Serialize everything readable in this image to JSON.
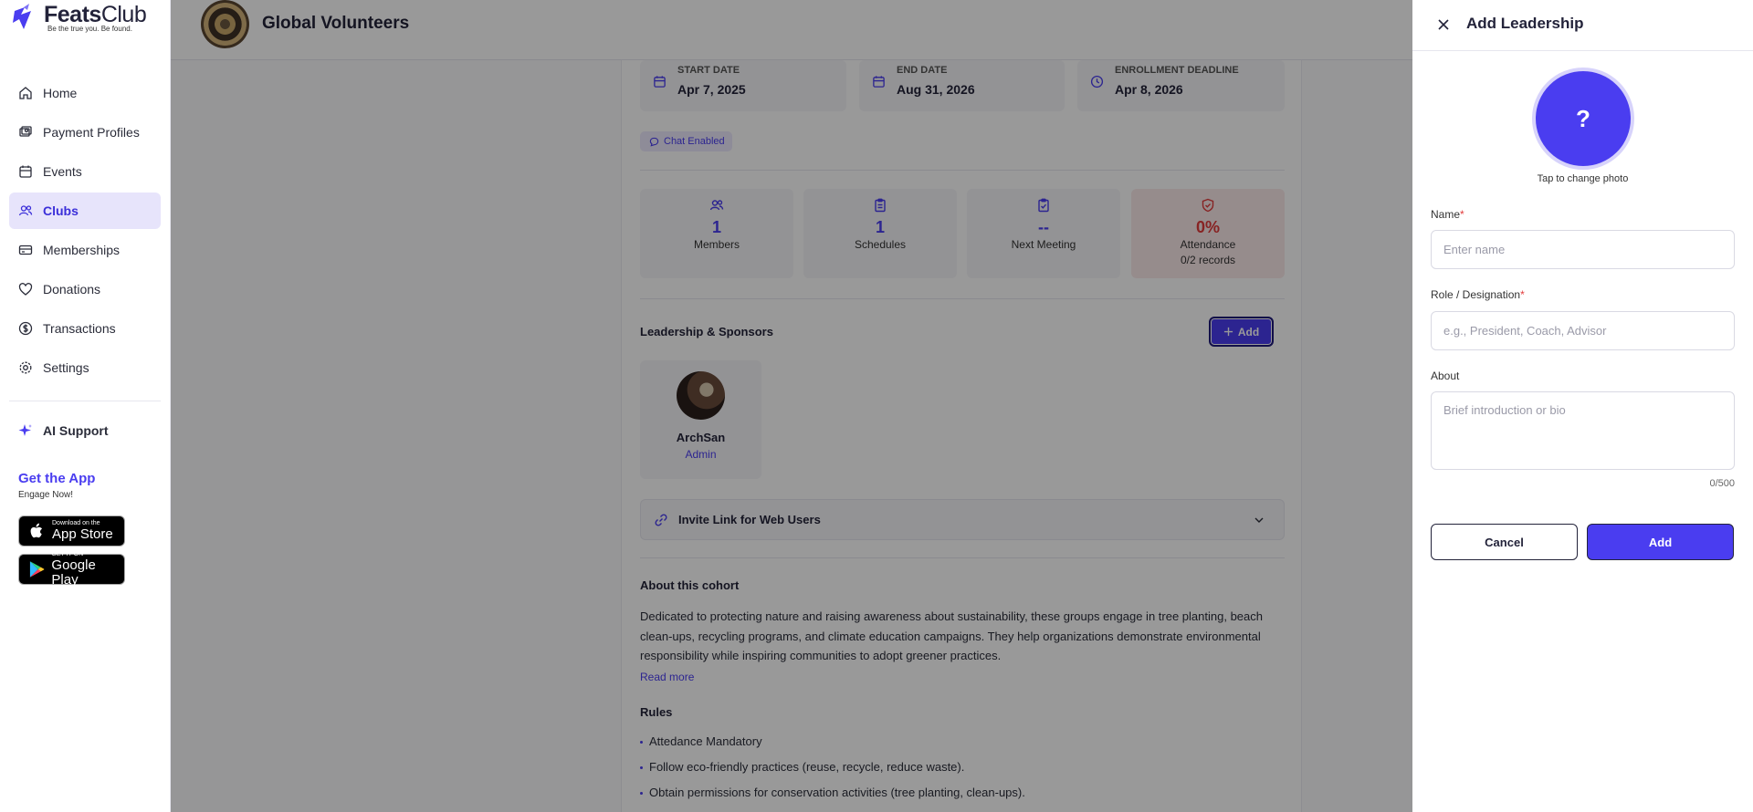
{
  "brand": {
    "name_bold": "Feats",
    "name_light": "Club",
    "tagline": "Be the true you. Be found."
  },
  "colors": {
    "accent": "#4a3df0",
    "danger": "#e23b3b",
    "active_bg": "#e7e4fb"
  },
  "sidebar": {
    "items": [
      {
        "label": "Home",
        "icon": "home-icon"
      },
      {
        "label": "Payment Profiles",
        "icon": "payment-profiles-icon"
      },
      {
        "label": "Events",
        "icon": "calendar-icon"
      },
      {
        "label": "Clubs",
        "icon": "users-icon",
        "active": true
      },
      {
        "label": "Memberships",
        "icon": "card-icon"
      },
      {
        "label": "Donations",
        "icon": "heart-icon"
      },
      {
        "label": "Transactions",
        "icon": "dollar-icon"
      },
      {
        "label": "Settings",
        "icon": "gear-icon"
      }
    ],
    "ai_support": "AI Support",
    "get_app": {
      "title": "Get the App",
      "subtitle": "Engage Now!"
    },
    "app_store": {
      "line1": "Download on the",
      "line2": "App Store"
    },
    "google_play": {
      "line1": "GET IT ON",
      "line2": "Google Play"
    }
  },
  "header": {
    "club_name": "Global Volunteers"
  },
  "dates": [
    {
      "label": "START DATE",
      "value": "Apr 7, 2025"
    },
    {
      "label": "END DATE",
      "value": "Aug 31, 2026"
    },
    {
      "label": "ENROLLMENT DEADLINE",
      "value": "Apr 8, 2026"
    }
  ],
  "chip": "Chat Enabled",
  "stats": [
    {
      "value": "1",
      "label": "Members"
    },
    {
      "value": "1",
      "label": "Schedules"
    },
    {
      "value": "--",
      "label": "Next Meeting"
    },
    {
      "value": "0%",
      "label": "Attendance",
      "sub": "0/2 records"
    }
  ],
  "leadership": {
    "title": "Leadership & Sponsors",
    "add_label": "Add",
    "members": [
      {
        "name": "ArchSan",
        "role": "Admin"
      }
    ]
  },
  "invite": {
    "label": "Invite Link for Web Users"
  },
  "about": {
    "title": "About this cohort",
    "text": "Dedicated to protecting nature and raising awareness about sustainability, these groups engage in tree planting, beach clean-ups, recycling programs, and climate education campaigns. They help organizations demonstrate environmental responsibility while inspiring communities to adopt greener practices.",
    "read_more": "Read more"
  },
  "rules": {
    "title": "Rules",
    "items": [
      "Attedance Mandatory",
      "Follow eco-friendly practices (reuse, recycle, reduce waste).",
      "Obtain permissions for conservation activities (tree planting, clean-ups)."
    ]
  },
  "drawer": {
    "title": "Add Leadership",
    "photo_placeholder": "?",
    "photo_caption": "Tap to change photo",
    "name_label": "Name",
    "name_placeholder": "Enter name",
    "role_label": "Role / Designation",
    "role_placeholder": "e.g., President, Coach, Advisor",
    "about_label": "About",
    "about_placeholder": "Brief introduction or bio",
    "counter": "0/500",
    "required_mark": "*",
    "cancel_label": "Cancel",
    "add_label": "Add"
  }
}
